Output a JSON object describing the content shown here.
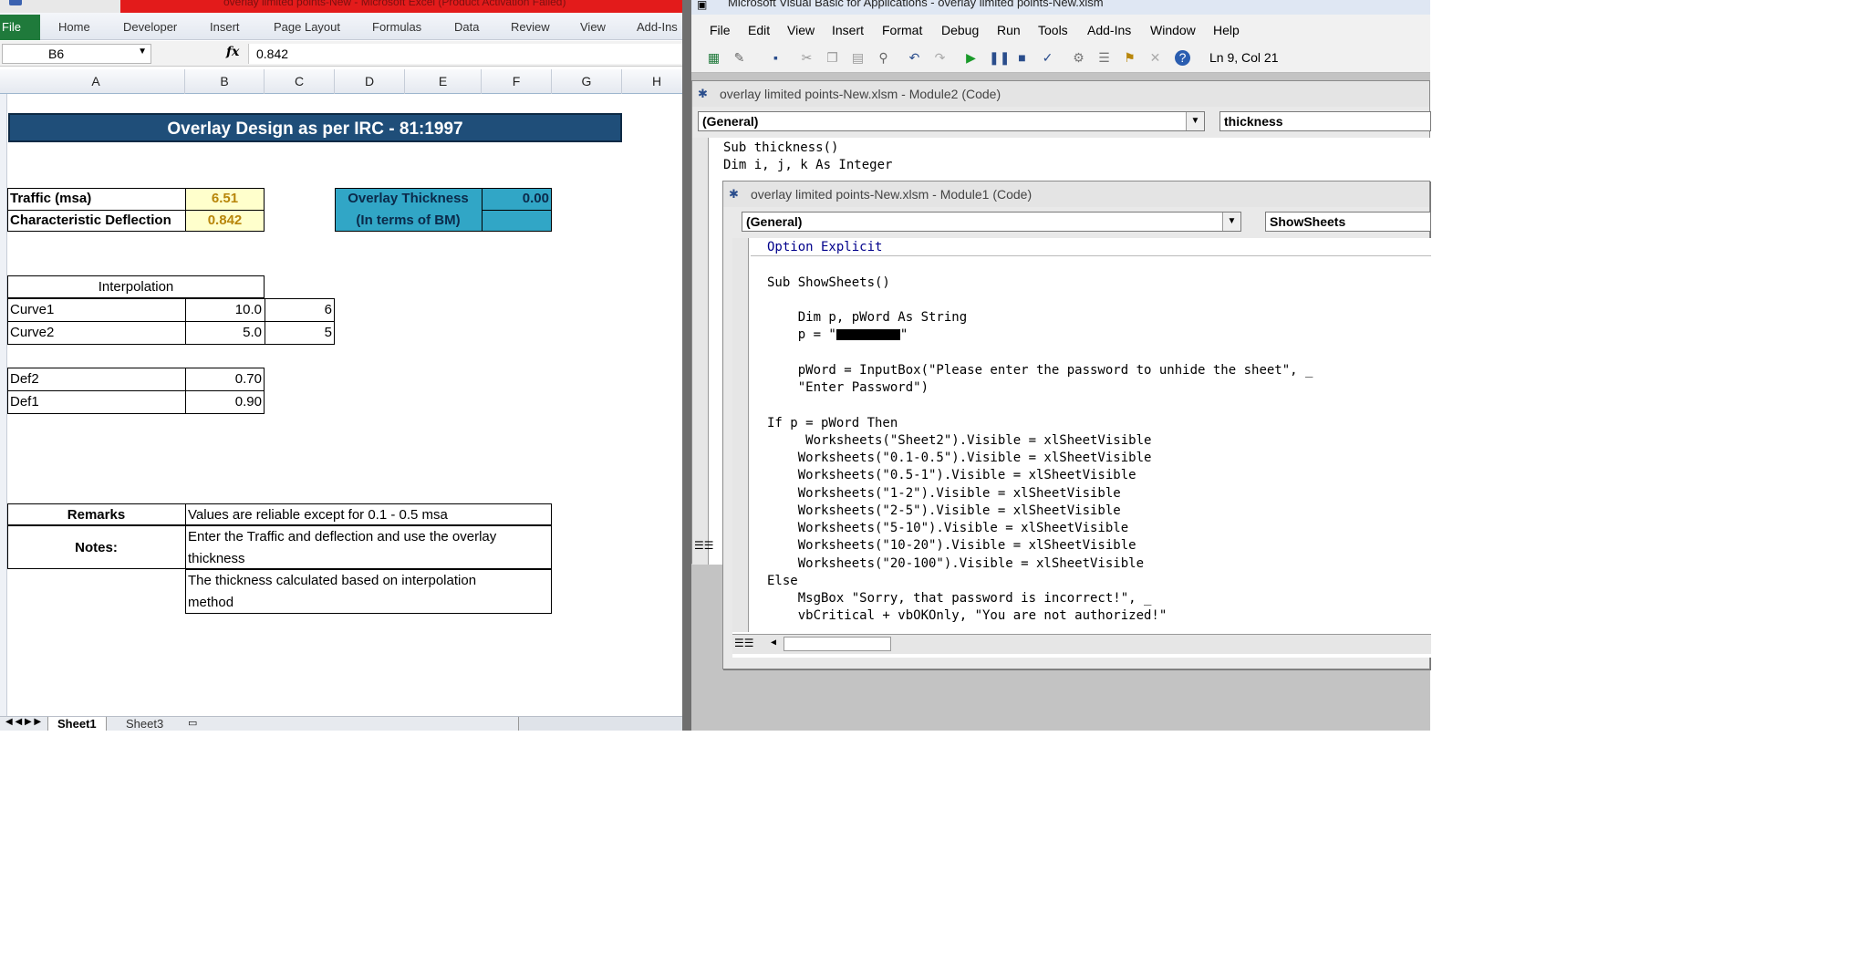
{
  "excel": {
    "title": "overlay limited points-New - Microsoft Excel (Product Activation Failed)",
    "ribbon": {
      "file": "File",
      "tabs": [
        "Home",
        "Developer",
        "Insert",
        "Page Layout",
        "Formulas",
        "Data",
        "Review",
        "View",
        "Add-Ins"
      ]
    },
    "name_box": "B6",
    "fx": "fx",
    "formula": "0.842",
    "columns": [
      "A",
      "B",
      "C",
      "D",
      "E",
      "F",
      "G",
      "H"
    ],
    "banner": "Overlay Design as per IRC - 81:1997",
    "traffic_label": "Traffic (msa)",
    "traffic_value": "6.51",
    "deflection_label": "Characteristic Deflection",
    "deflection_value": "0.842",
    "overlay_label1": "Overlay Thickness",
    "overlay_value": "0.00",
    "overlay_label2": "(In terms of BM)",
    "interp_title": "Interpolation",
    "curve1_label": "Curve1",
    "curve1_b": "10.0",
    "curve1_c": "6",
    "curve2_label": "Curve2",
    "curve2_b": "5.0",
    "curve2_c": "5",
    "def2_label": "Def2",
    "def2_value": "0.70",
    "def1_label": "Def1",
    "def1_value": "0.90",
    "remarks_label": "Remarks",
    "remarks_text": "Values are reliable except for 0.1 - 0.5 msa",
    "notes_label": "Notes:",
    "notes_line1": "Enter the Traffic and deflection and use the overlay",
    "notes_line2": "thickness",
    "notes_line3": "The thickness calculated based on interpolation",
    "notes_line4": "method",
    "sheet_tabs": [
      "Sheet1",
      "Sheet3"
    ]
  },
  "vbe": {
    "title": "Microsoft Visual Basic for Applications - overlay limited points-New.xlsm",
    "menu": [
      "File",
      "Edit",
      "View",
      "Insert",
      "Format",
      "Debug",
      "Run",
      "Tools",
      "Add-Ins",
      "Window",
      "Help"
    ],
    "status": "Ln 9, Col 21",
    "module2": {
      "title": "overlay limited points-New.xlsm - Module2 (Code)",
      "object": "(General)",
      "proc": "thickness",
      "lines": [
        "Sub thickness()",
        "Dim i, j, k As Integer"
      ]
    },
    "module1": {
      "title": "overlay limited points-New.xlsm - Module1 (Code)",
      "object": "(General)",
      "proc": "ShowSheets",
      "lines": [
        "Option Explicit",
        "",
        "Sub ShowSheets()",
        "",
        "    Dim p, pWord As String",
        "    p = \"",
        "",
        "    pWord = InputBox(\"Please enter the password to unhide the sheet\", _",
        "    \"Enter Password\")",
        "",
        "If p = pWord Then",
        "     Worksheets(\"Sheet2\").Visible = xlSheetVisible",
        "    Worksheets(\"0.1-0.5\").Visible = xlSheetVisible",
        "    Worksheets(\"0.5-1\").Visible = xlSheetVisible",
        "    Worksheets(\"1-2\").Visible = xlSheetVisible",
        "    Worksheets(\"2-5\").Visible = xlSheetVisible",
        "    Worksheets(\"5-10\").Visible = xlSheetVisible",
        "    Worksheets(\"10-20\").Visible = xlSheetVisible",
        "    Worksheets(\"20-100\").Visible = xlSheetVisible",
        "Else",
        "    MsgBox \"Sorry, that password is incorrect!\", _",
        "    vbCritical + vbOKOnly, \"You are not authorized!\""
      ],
      "line6_tail": "\""
    }
  }
}
